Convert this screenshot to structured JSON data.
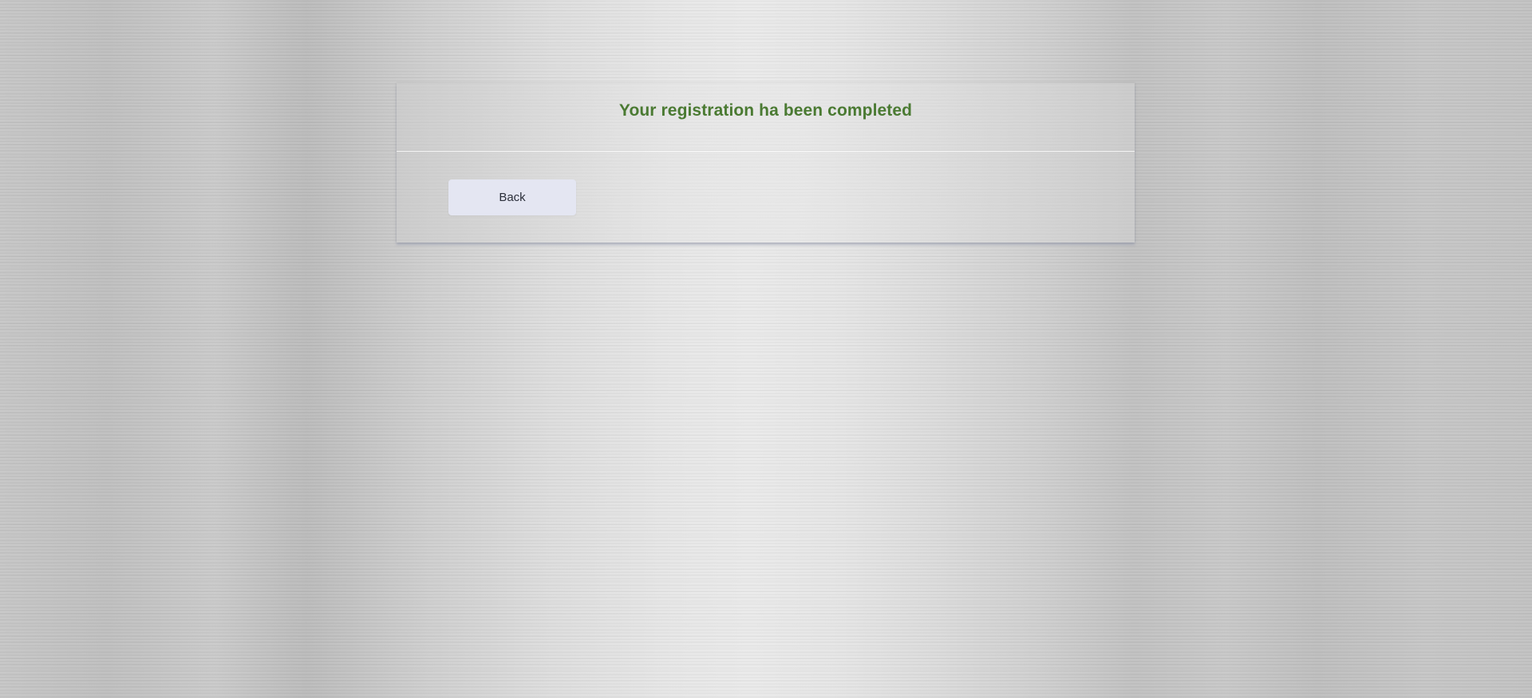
{
  "header": {
    "title": "Your registration ha been completed"
  },
  "actions": {
    "back_label": "Back"
  },
  "colors": {
    "title": "#4a7a32",
    "button_bg": "#e4e6f2",
    "button_text": "#2b2f3a"
  }
}
